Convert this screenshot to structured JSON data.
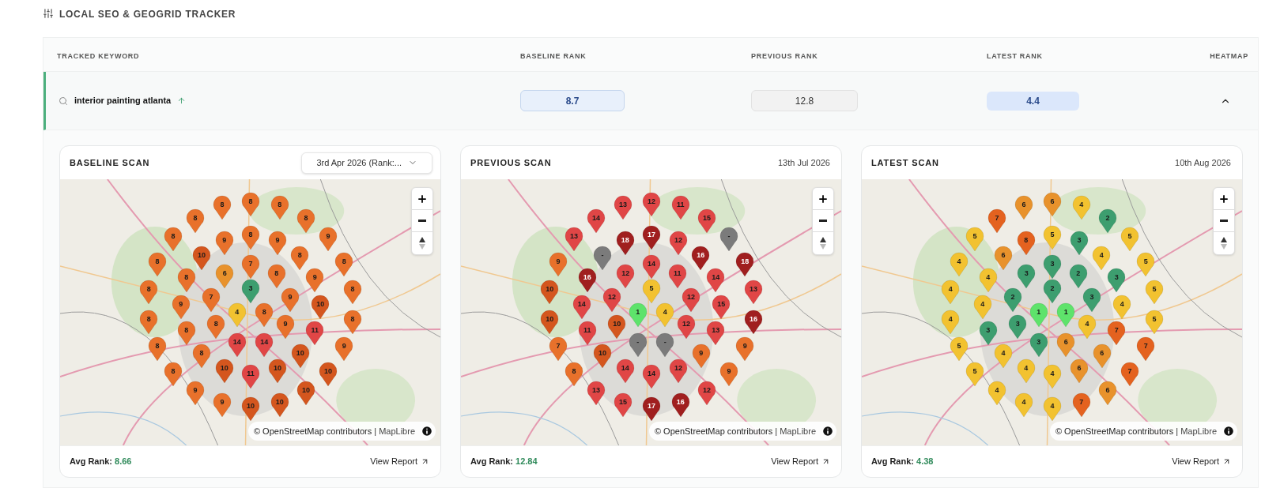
{
  "section_title": "LOCAL SEO & GEOGRID TRACKER",
  "table": {
    "columns": [
      "TRACKED KEYWORD",
      "BASELINE RANK",
      "PREVIOUS RANK",
      "LATEST RANK",
      "HEATMAP"
    ],
    "rows": [
      {
        "keyword": "interior painting atlanta",
        "improved": true,
        "ranks": [
          "8.7",
          "12.8",
          "4.4"
        ],
        "expanded": true
      }
    ]
  },
  "scans": [
    {
      "title": "BASELINE SCAN",
      "kind": "dropdown",
      "date": "3rd Apr 2026 (Rank:...",
      "attribution": "© OpenStreetMap contributors",
      "separator": "|",
      "attribution_link": "MapLibre",
      "avg_label": "Avg Rank:",
      "avg_rank": "8.66",
      "report_link": "View Report",
      "pins": [
        {
          "label": "8",
          "color": "#e8712b"
        },
        {
          "label": "8",
          "color": "#e8712b"
        },
        {
          "label": "8",
          "color": "#e8712b"
        },
        {
          "label": "8",
          "color": "#e8712b"
        },
        {
          "label": "8",
          "color": "#e8712b"
        },
        {
          "label": "8",
          "color": "#e8712b"
        },
        {
          "label": "9",
          "color": "#e8712b"
        },
        {
          "label": "8",
          "color": "#e8712b"
        },
        {
          "label": "9",
          "color": "#e8712b"
        },
        {
          "label": "9",
          "color": "#e8712b"
        },
        {
          "label": "8",
          "color": "#e8712b"
        },
        {
          "label": "10",
          "color": "#d4561e"
        },
        {
          "label": "7",
          "color": "#e8712b"
        },
        {
          "label": "8",
          "color": "#e8712b"
        },
        {
          "label": "8",
          "color": "#e8712b"
        },
        {
          "label": "8",
          "color": "#e8712b"
        },
        {
          "label": "6",
          "color": "#e8922c"
        },
        {
          "label": "8",
          "color": "#e8712b"
        },
        {
          "label": "9",
          "color": "#e8712b"
        },
        {
          "label": "8",
          "color": "#e8712b"
        },
        {
          "label": "3",
          "color": "#3d9e6f"
        },
        {
          "label": "8",
          "color": "#e8712b"
        },
        {
          "label": "9",
          "color": "#e8712b"
        },
        {
          "label": "7",
          "color": "#e8712b"
        },
        {
          "label": "9",
          "color": "#e8712b"
        },
        {
          "label": "10",
          "color": "#d4561e"
        },
        {
          "label": "4",
          "color": "#f2c230"
        },
        {
          "label": "8",
          "color": "#e8712b"
        },
        {
          "label": "8",
          "color": "#e8712b"
        },
        {
          "label": "8",
          "color": "#e8712b"
        },
        {
          "label": "9",
          "color": "#e8712b"
        },
        {
          "label": "8",
          "color": "#e8712b"
        },
        {
          "label": "8",
          "color": "#e8712b"
        },
        {
          "label": "11",
          "color": "#e04646"
        },
        {
          "label": "8",
          "color": "#e8712b"
        },
        {
          "label": "14",
          "color": "#e04646"
        },
        {
          "label": "14",
          "color": "#e04646"
        },
        {
          "label": "9",
          "color": "#e8712b"
        },
        {
          "label": "8",
          "color": "#e8712b"
        },
        {
          "label": "10",
          "color": "#d4561e"
        },
        {
          "label": "8",
          "color": "#e8712b"
        },
        {
          "label": "10",
          "color": "#d4561e"
        },
        {
          "label": "11",
          "color": "#e04646"
        },
        {
          "label": "10",
          "color": "#d4561e"
        },
        {
          "label": "10",
          "color": "#d4561e"
        },
        {
          "label": "9",
          "color": "#e8712b"
        },
        {
          "label": "10",
          "color": "#d4561e"
        },
        {
          "label": "9",
          "color": "#e8712b"
        },
        {
          "label": "10",
          "color": "#d4561e"
        },
        {
          "label": "10",
          "color": "#d4561e"
        }
      ]
    },
    {
      "title": "PREVIOUS SCAN",
      "kind": "date",
      "date": "13th Jul 2026",
      "attribution": "© OpenStreetMap contributors",
      "separator": "|",
      "attribution_link": "MapLibre",
      "avg_label": "Avg Rank:",
      "avg_rank": "12.84",
      "report_link": "View Report",
      "pins": [
        {
          "label": "13",
          "color": "#e04646"
        },
        {
          "label": "12",
          "color": "#e04646"
        },
        {
          "label": "11",
          "color": "#e04646"
        },
        {
          "label": "14",
          "color": "#e04646"
        },
        {
          "label": "15",
          "color": "#e04646"
        },
        {
          "label": "13",
          "color": "#e04646"
        },
        {
          "label": "18",
          "color": "#a01f1f"
        },
        {
          "label": "17",
          "color": "#a01f1f"
        },
        {
          "label": "12",
          "color": "#e04646"
        },
        {
          "label": "-",
          "color": "#7b7b7b"
        },
        {
          "label": "9",
          "color": "#e8712b"
        },
        {
          "label": "-",
          "color": "#7b7b7b"
        },
        {
          "label": "14",
          "color": "#e04646"
        },
        {
          "label": "16",
          "color": "#a01f1f"
        },
        {
          "label": "18",
          "color": "#a01f1f"
        },
        {
          "label": "16",
          "color": "#a01f1f"
        },
        {
          "label": "12",
          "color": "#e04646"
        },
        {
          "label": "11",
          "color": "#e04646"
        },
        {
          "label": "14",
          "color": "#e04646"
        },
        {
          "label": "10",
          "color": "#d4561e"
        },
        {
          "label": "5",
          "color": "#f2c230"
        },
        {
          "label": "13",
          "color": "#e04646"
        },
        {
          "label": "14",
          "color": "#e04646"
        },
        {
          "label": "12",
          "color": "#e04646"
        },
        {
          "label": "12",
          "color": "#e04646"
        },
        {
          "label": "15",
          "color": "#e04646"
        },
        {
          "label": "1",
          "color": "#5ee36b"
        },
        {
          "label": "4",
          "color": "#f2c230"
        },
        {
          "label": "10",
          "color": "#d4561e"
        },
        {
          "label": "10",
          "color": "#d4561e"
        },
        {
          "label": "12",
          "color": "#e04646"
        },
        {
          "label": "16",
          "color": "#a01f1f"
        },
        {
          "label": "11",
          "color": "#e04646"
        },
        {
          "label": "13",
          "color": "#e04646"
        },
        {
          "label": "7",
          "color": "#e8712b"
        },
        {
          "label": "-",
          "color": "#7b7b7b"
        },
        {
          "label": "-",
          "color": "#7b7b7b"
        },
        {
          "label": "9",
          "color": "#e8712b"
        },
        {
          "label": "10",
          "color": "#d4561e"
        },
        {
          "label": "9",
          "color": "#e8712b"
        },
        {
          "label": "8",
          "color": "#e8712b"
        },
        {
          "label": "14",
          "color": "#e04646"
        },
        {
          "label": "14",
          "color": "#e04646"
        },
        {
          "label": "12",
          "color": "#e04646"
        },
        {
          "label": "9",
          "color": "#e8712b"
        },
        {
          "label": "13",
          "color": "#e04646"
        },
        {
          "label": "12",
          "color": "#e04646"
        },
        {
          "label": "15",
          "color": "#e04646"
        },
        {
          "label": "17",
          "color": "#a01f1f"
        },
        {
          "label": "16",
          "color": "#a01f1f"
        }
      ]
    },
    {
      "title": "LATEST SCAN",
      "kind": "date",
      "date": "10th Aug 2026",
      "attribution": "© OpenStreetMap contributors",
      "separator": "|",
      "attribution_link": "MapLibre",
      "avg_label": "Avg Rank:",
      "avg_rank": "4.38",
      "report_link": "View Report",
      "pins": [
        {
          "label": "6",
          "color": "#e8922c"
        },
        {
          "label": "6",
          "color": "#e8922c"
        },
        {
          "label": "4",
          "color": "#f2c230"
        },
        {
          "label": "7",
          "color": "#e4621f"
        },
        {
          "label": "2",
          "color": "#3d9e6f"
        },
        {
          "label": "5",
          "color": "#f2c230"
        },
        {
          "label": "8",
          "color": "#e4621f"
        },
        {
          "label": "5",
          "color": "#f2c230"
        },
        {
          "label": "3",
          "color": "#3d9e6f"
        },
        {
          "label": "5",
          "color": "#f2c230"
        },
        {
          "label": "4",
          "color": "#f2c230"
        },
        {
          "label": "6",
          "color": "#e8922c"
        },
        {
          "label": "3",
          "color": "#3d9e6f"
        },
        {
          "label": "4",
          "color": "#f2c230"
        },
        {
          "label": "5",
          "color": "#f2c230"
        },
        {
          "label": "4",
          "color": "#f2c230"
        },
        {
          "label": "3",
          "color": "#3d9e6f"
        },
        {
          "label": "2",
          "color": "#3d9e6f"
        },
        {
          "label": "3",
          "color": "#3d9e6f"
        },
        {
          "label": "4",
          "color": "#f2c230"
        },
        {
          "label": "2",
          "color": "#3d9e6f"
        },
        {
          "label": "5",
          "color": "#f2c230"
        },
        {
          "label": "4",
          "color": "#f2c230"
        },
        {
          "label": "2",
          "color": "#3d9e6f"
        },
        {
          "label": "3",
          "color": "#3d9e6f"
        },
        {
          "label": "4",
          "color": "#f2c230"
        },
        {
          "label": "1",
          "color": "#5ee36b"
        },
        {
          "label": "1",
          "color": "#5ee36b"
        },
        {
          "label": "4",
          "color": "#f2c230"
        },
        {
          "label": "3",
          "color": "#3d9e6f"
        },
        {
          "label": "4",
          "color": "#f2c230"
        },
        {
          "label": "5",
          "color": "#f2c230"
        },
        {
          "label": "3",
          "color": "#3d9e6f"
        },
        {
          "label": "7",
          "color": "#e4621f"
        },
        {
          "label": "5",
          "color": "#f2c230"
        },
        {
          "label": "3",
          "color": "#3d9e6f"
        },
        {
          "label": "6",
          "color": "#e8922c"
        },
        {
          "label": "7",
          "color": "#e4621f"
        },
        {
          "label": "4",
          "color": "#f2c230"
        },
        {
          "label": "6",
          "color": "#e8922c"
        },
        {
          "label": "5",
          "color": "#f2c230"
        },
        {
          "label": "4",
          "color": "#f2c230"
        },
        {
          "label": "4",
          "color": "#f2c230"
        },
        {
          "label": "6",
          "color": "#e8922c"
        },
        {
          "label": "7",
          "color": "#e4621f"
        },
        {
          "label": "4",
          "color": "#f2c230"
        },
        {
          "label": "6",
          "color": "#e8922c"
        },
        {
          "label": "4",
          "color": "#f2c230"
        },
        {
          "label": "4",
          "color": "#f2c230"
        },
        {
          "label": "7",
          "color": "#e4621f"
        }
      ]
    }
  ]
}
